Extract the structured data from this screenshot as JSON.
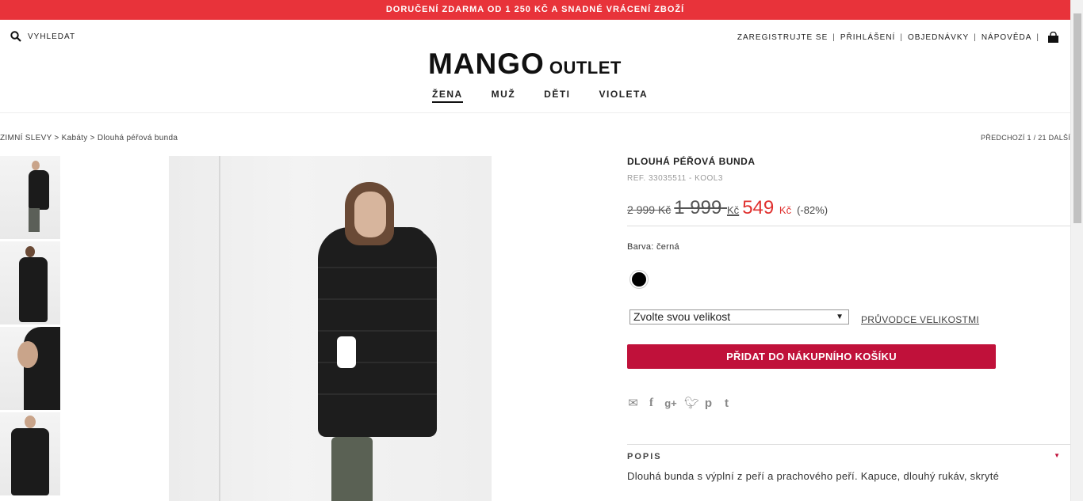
{
  "promo": {
    "text": "DORUČENÍ ZDARMA OD 1 250 KČ A SNADNÉ VRÁCENÍ ZBOŽÍ"
  },
  "header": {
    "search_label": "VYHLEDAT",
    "links": [
      "ZAREGISTRUJTE SE",
      "PŘIHLÁŠENÍ",
      "OBJEDNÁVKY",
      "NÁPOVĚDA"
    ],
    "logo_main": "MANGO",
    "logo_sub": "OUTLET",
    "nav": [
      {
        "label": "ŽENA",
        "active": true
      },
      {
        "label": "MUŽ",
        "active": false
      },
      {
        "label": "DĚTI",
        "active": false
      },
      {
        "label": "VIOLETA",
        "active": false
      }
    ]
  },
  "breadcrumb": {
    "text": "ZIMNÍ SLEVY > Kabáty > Dlouhá péřová bunda"
  },
  "pager": {
    "text": "PŘEDCHOZÍ 1 / 21 DALŠÍ"
  },
  "product": {
    "title": "DLOUHÁ PÉŘOVÁ BUNDA",
    "ref": "REF. 33035511 - KOOL3",
    "price_original": "2 999",
    "price_original_currency": "Kč",
    "price_previous": "1 999",
    "price_previous_currency": "Kč",
    "price_current": "549",
    "price_current_currency": "Kč",
    "discount": "(-82%)",
    "color_label": "Barva: černá",
    "color_swatch": "#000000",
    "size_placeholder": "Zvolte svou velikost",
    "size_guide": "PRŮVODCE VELIKOSTMI",
    "add_to_cart": "PŘIDAT DO NÁKUPNÍHO KOŠÍKU",
    "share_icons": [
      "mail-icon",
      "facebook-icon",
      "google-plus-icon",
      "twitter-icon",
      "pinterest-icon",
      "tumblr-icon"
    ],
    "description_heading": "POPIS",
    "description_text": "Dlouhá bunda s výplní z peří a prachového peří. Kapuce, dlouhý rukáv, skryté"
  },
  "colors": {
    "promo_bg": "#e8333a",
    "accent": "#c0113a",
    "sale_price": "#e0312f"
  }
}
